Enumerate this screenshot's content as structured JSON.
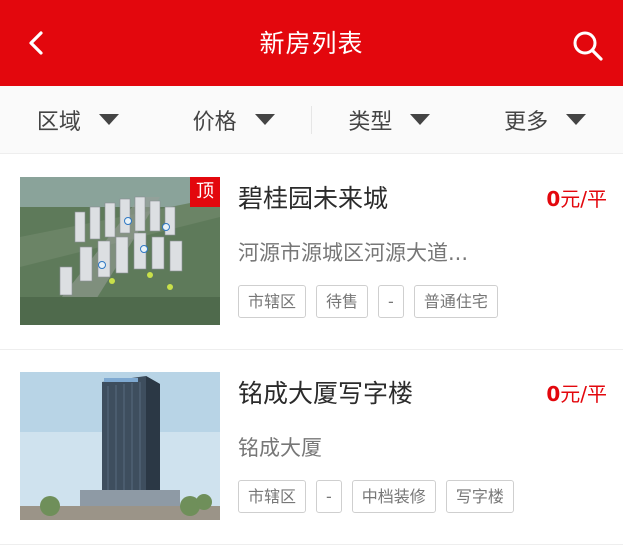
{
  "header": {
    "title": "新房列表",
    "back_icon": "chevron-left-icon",
    "search_icon": "search-icon",
    "bg_color": "#e3070d"
  },
  "filters": [
    {
      "label": "区域"
    },
    {
      "label": "价格"
    },
    {
      "label": "类型"
    },
    {
      "label": "更多"
    }
  ],
  "listings": [
    {
      "badge": "顶",
      "name": "碧桂园未来城",
      "price_value": "0",
      "price_unit": "元/平",
      "address": "河源市源城区河源大道...",
      "tags": [
        "市辖区",
        "待售",
        "-",
        "普通住宅"
      ]
    },
    {
      "name": "铭成大厦写字楼",
      "price_value": "0",
      "price_unit": "元/平",
      "address": "铭成大厦",
      "tags": [
        "市辖区",
        "-",
        "中档装修",
        "写字楼"
      ]
    }
  ],
  "accent_color": "#e3070d"
}
